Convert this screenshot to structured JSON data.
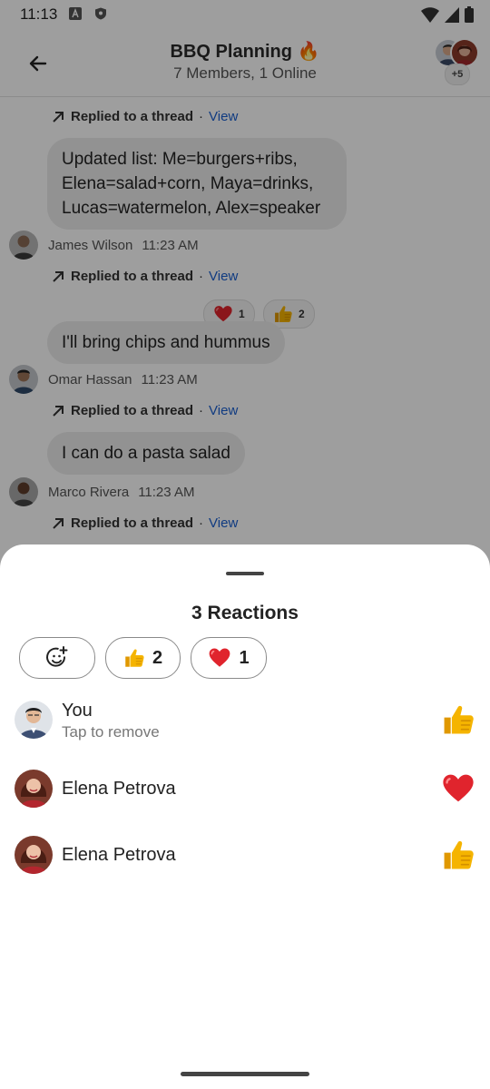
{
  "status_bar": {
    "time": "11:13"
  },
  "header": {
    "title": "BBQ Planning 🔥",
    "subtitle": "7 Members, 1 Online",
    "more_members": "+5"
  },
  "chat": {
    "reply_label": "Replied to a thread",
    "reply_separator": "·",
    "view_label": "View",
    "messages": [
      {
        "text": "Updated list: Me=burgers+ribs, Elena=salad+corn, Maya=drinks, Lucas=watermelon, Alex=speaker",
        "sender": "James Wilson",
        "time": "11:23 AM"
      },
      {
        "text": "I'll bring chips and hummus",
        "sender": "Omar Hassan",
        "time": "11:23 AM",
        "reactions": [
          {
            "emoji": "heart",
            "count": "1"
          },
          {
            "emoji": "thumbs-up",
            "count": "2"
          }
        ]
      },
      {
        "text": "I can do a pasta salad",
        "sender": "Marco Rivera",
        "time": "11:23 AM"
      }
    ]
  },
  "sheet": {
    "title": "3 Reactions",
    "filters": [
      {
        "icon": "add-reaction-icon"
      },
      {
        "icon": "thumbs-up",
        "count": "2"
      },
      {
        "icon": "heart",
        "count": "1"
      }
    ],
    "reactions": [
      {
        "name": "You",
        "hint": "Tap to remove",
        "emoji": "thumbs-up"
      },
      {
        "name": "Elena Petrova",
        "emoji": "heart"
      },
      {
        "name": "Elena Petrova",
        "emoji": "thumbs-up"
      }
    ]
  },
  "colors": {
    "link": "#1a5fd0",
    "bubble": "#ececec",
    "scrim": "rgba(0,0,0,0.38)",
    "heart": "#e0242d",
    "thumb": "#f5b400"
  }
}
